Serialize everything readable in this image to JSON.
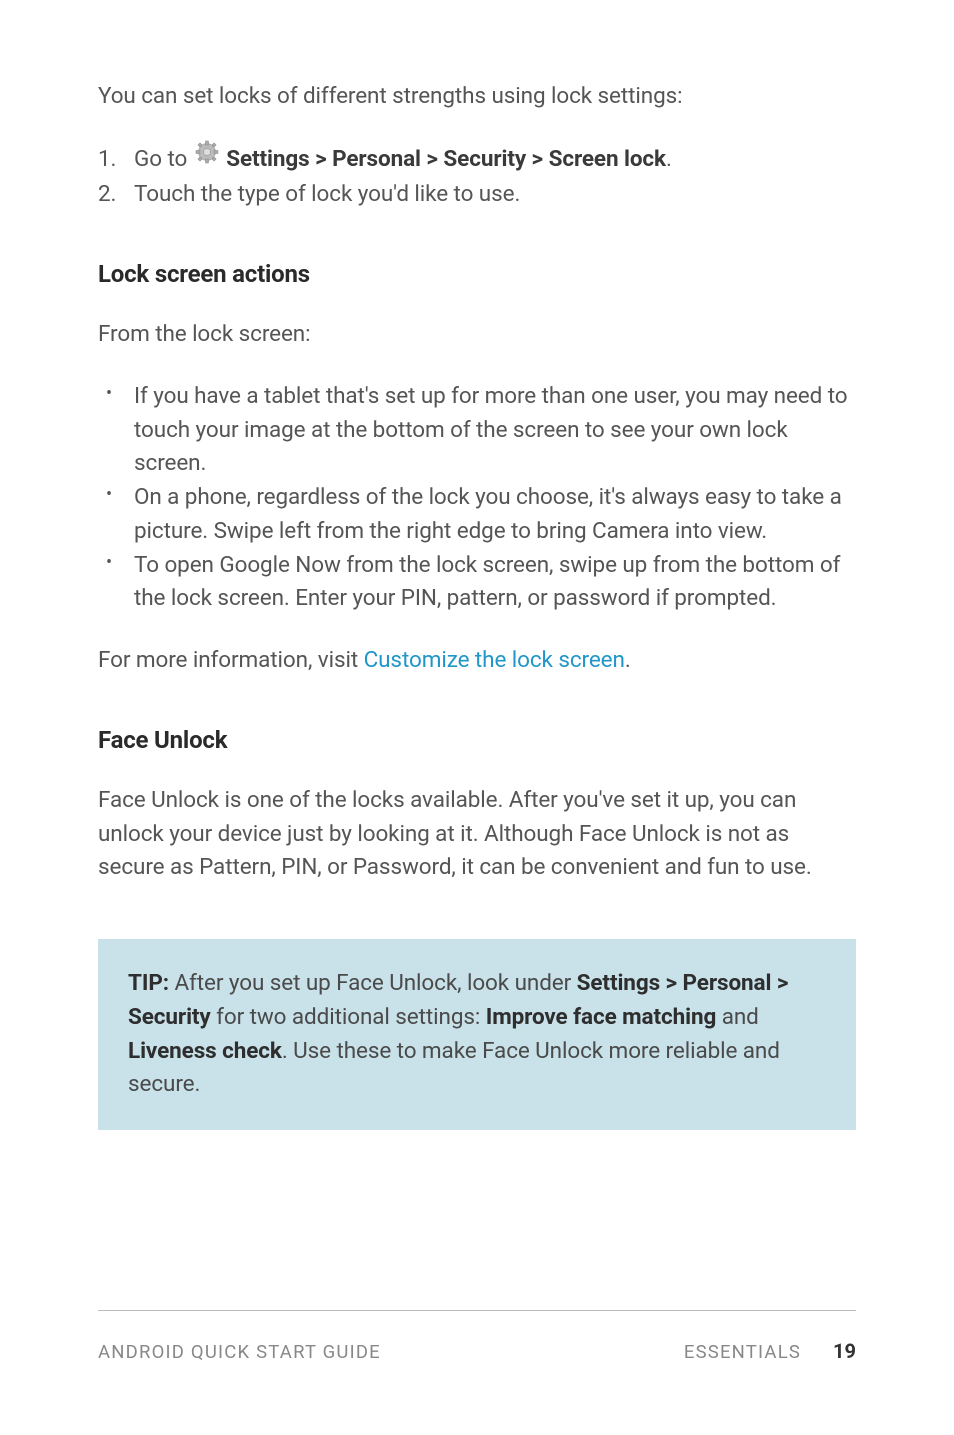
{
  "intro": "You can set locks of different strengths using lock settings:",
  "steps": {
    "item1_num": "1.",
    "item1_prefix": "Go to ",
    "item1_bold": "Settings > Personal > Security > Screen lock",
    "item1_suffix": ".",
    "item2_num": "2.",
    "item2_text": "Touch the type of lock you'd like to use."
  },
  "lock_screen": {
    "heading": "Lock screen actions",
    "intro": "From the lock screen:",
    "bullets": {
      "b1": "If you have a tablet that's set up for more than one user, you may need to touch your image at the bottom of the screen to see your own lock screen.",
      "b2": "On a phone, regardless of the lock you choose, it's always easy to take a picture. Swipe left from the right edge to bring Camera into view.",
      "b3": "To open Google Now from the lock screen, swipe up from the bottom of the lock screen. Enter your PIN, pattern, or pass­word if prompted."
    },
    "more_info_prefix": "For more information, visit ",
    "more_info_link": "Customize the lock screen",
    "more_info_suffix": "."
  },
  "face_unlock": {
    "heading": "Face Unlock",
    "para": "Face Unlock is one of the locks available. After you've set it up, you can unlock your device just by looking at it. Although Face Unlock is not as secure as Pattern, PIN, or Password, it can be convenient and fun to use."
  },
  "tip": {
    "label": "TIP:",
    "t1": " After you set up Face Unlock, look under ",
    "b1": "Settings > Personal > Security",
    "t2": " for two additional settings: ",
    "b2": "Improve face matching",
    "t3": " and ",
    "b3": "Liveness check",
    "t4": ". Use these to make Face Unlock more reliable and secure."
  },
  "footer": {
    "left": "ANDROID QUICK START GUIDE",
    "right_label": "ESSENTIALS",
    "page": "19"
  }
}
